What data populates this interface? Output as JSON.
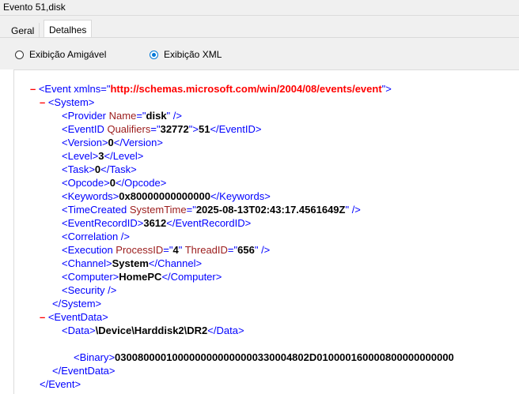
{
  "window": {
    "title": "Evento 51,disk"
  },
  "tabs": [
    {
      "label": "Geral",
      "active": false
    },
    {
      "label": "Detalhes",
      "active": true
    }
  ],
  "view_options": [
    {
      "label": "Exibição Amigável",
      "selected": false
    },
    {
      "label": "Exibição XML",
      "selected": true
    }
  ],
  "xml": {
    "event_open": "<Event xmlns=",
    "xmlns": "http://schemas.microsoft.com/win/2004/08/events/event",
    "provider_name": "disk",
    "qualifiers": "32772",
    "event_id": "51",
    "version": "0",
    "level": "3",
    "task": "0",
    "opcode": "0",
    "keywords": "0x80000000000000",
    "system_time": "2025-08-13T02:43:17.4561649Z",
    "record_id": "3612",
    "process_id": "4",
    "thread_id": "656",
    "channel": "System",
    "computer": "HomePC",
    "data": "\\Device\\Harddisk2\\DR2",
    "binary": "0300800001000000000000000330004802D010000160000800000000000"
  }
}
